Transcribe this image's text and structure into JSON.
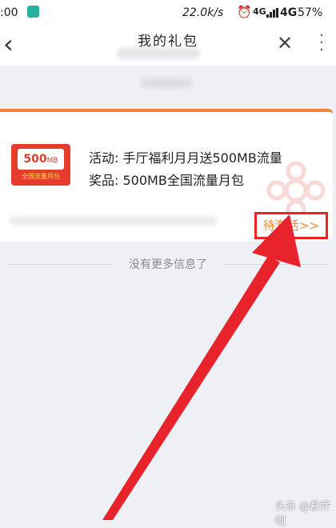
{
  "status_bar": {
    "time": ":00",
    "speed": "22.0k/s",
    "signal_label": "4G",
    "network": "4G",
    "battery": "57%"
  },
  "nav": {
    "back_icon": "chevron-left-icon",
    "title": "我的礼包",
    "close_icon": "close-icon",
    "more_icon": "more-vertical-icon"
  },
  "gift": {
    "icon_badge": "500",
    "icon_badge_unit": "MB",
    "icon_caption": "全国流量月包",
    "activity_label": "活动:",
    "activity_value": "手厅福利月月送500MB流量",
    "prize_label": "奖品:",
    "prize_value": "500MB全国流量月包",
    "activate_button": "待激活>>"
  },
  "footer_note": "没有更多信息了",
  "watermark": "头条 @悬乔啊",
  "colors": {
    "accent_orange": "#f47f38",
    "highlight_red": "#ee2222",
    "envelope_red": "#e63c2e",
    "background": "#eef0f6"
  }
}
